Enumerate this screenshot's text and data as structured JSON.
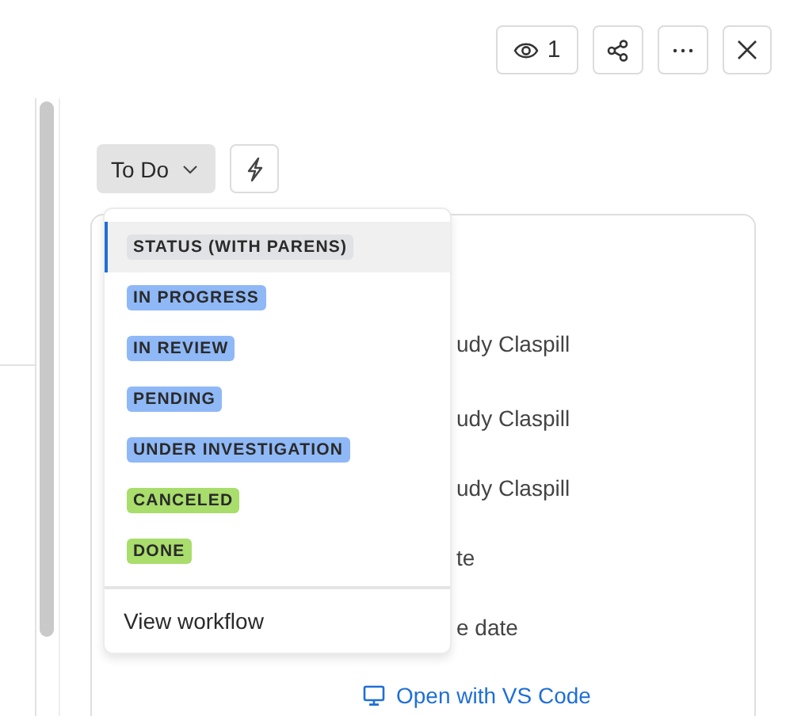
{
  "toolbar": {
    "watchers": "1"
  },
  "status_button": {
    "label": "To Do"
  },
  "status_menu": {
    "items": [
      {
        "label": "STATUS (WITH PARENS)",
        "color": "#e1e2e5",
        "selected": true
      },
      {
        "label": "IN PROGRESS",
        "color": "#8fb8f6",
        "selected": false
      },
      {
        "label": "IN REVIEW",
        "color": "#8fb8f6",
        "selected": false
      },
      {
        "label": "PENDING",
        "color": "#8fb8f6",
        "selected": false
      },
      {
        "label": "UNDER INVESTIGATION",
        "color": "#8fb8f6",
        "selected": false
      },
      {
        "label": "CANCELED",
        "color": "#a9dd6c",
        "selected": false
      },
      {
        "label": "DONE",
        "color": "#a9dd6c",
        "selected": false
      }
    ],
    "footer": "View workflow"
  },
  "details": {
    "rows": [
      "udy Claspill",
      "udy Claspill",
      "udy Claspill",
      "te",
      "e date"
    ],
    "link": "Open with VS Code"
  }
}
